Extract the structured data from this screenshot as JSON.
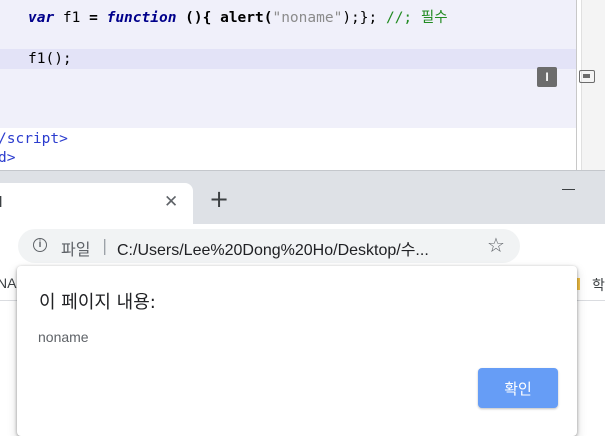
{
  "editor": {
    "line1": {
      "kw_var": "var",
      "name": " f1 ",
      "eq": "=",
      "kw_function": "function",
      "open": " (){ alert(",
      "string": "\"noname\"",
      "close": ");}; ",
      "comment": "//; 필수"
    },
    "line2": "f1();",
    "close_script": "/script>",
    "close_body": "d>"
  },
  "browser": {
    "tab_title": "l",
    "tab_close": "✕",
    "new_tab": "+",
    "scheme_label": "파일",
    "separator": "|",
    "url": "C:/Users/Lee%20Dong%20Ho/Desktop/수...",
    "star_icon": "☆",
    "extension_label": "I",
    "bookmark_left": "NA",
    "bookmark_right": "학"
  },
  "dialog": {
    "title": "이 페이지 내용:",
    "message": "noname",
    "ok_label": "확인"
  },
  "colors": {
    "ok_button": "#669df6",
    "tab_strip": "#dee1e6",
    "editor_band": "#f0f0fa"
  }
}
